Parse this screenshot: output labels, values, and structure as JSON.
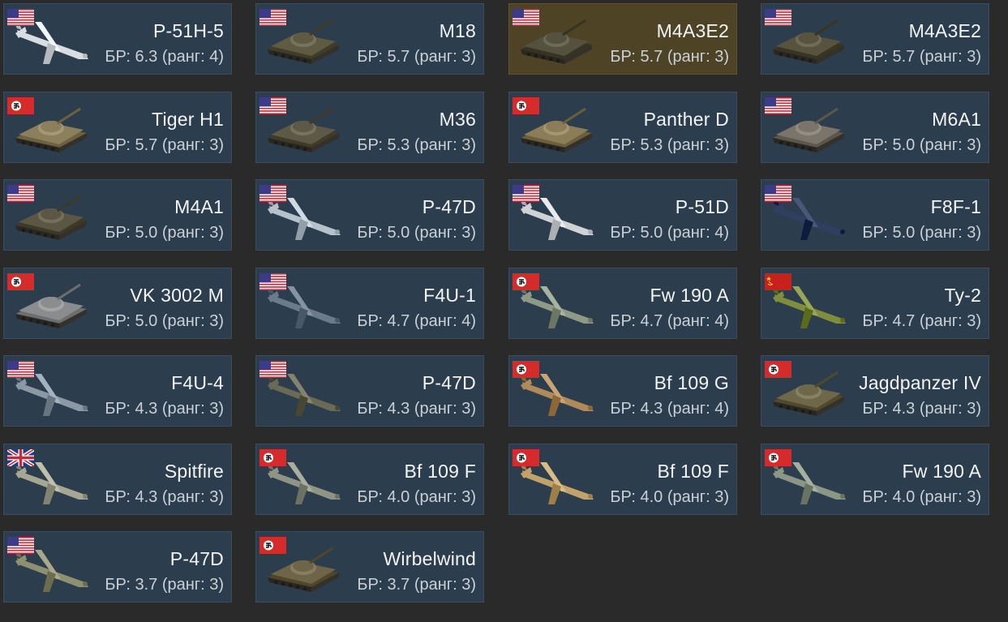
{
  "colors": {
    "background": "#2a2a2a",
    "card": "#2c3d4e",
    "card_selected": "#4e4425",
    "text_primary": "#f2f4f6",
    "text_secondary": "#c9d0d7"
  },
  "units": [
    {
      "name": "P-51H-5",
      "br": "БР: 6.3 (ранг: 4)",
      "flag": "usa-flag-icon",
      "kind": "plane",
      "color": "#d8dde2",
      "selected": false
    },
    {
      "name": "M18",
      "br": "БР: 5.7 (ранг: 3)",
      "flag": "usa-flag-icon",
      "kind": "tank",
      "color": "#5f5a44",
      "selected": false
    },
    {
      "name": "M4A3E2",
      "br": "БР: 5.7 (ранг: 3)",
      "flag": "usa-flag-icon",
      "kind": "tank",
      "color": "#54513f",
      "selected": true
    },
    {
      "name": "M4A3E2",
      "br": "БР: 5.7 (ранг: 3)",
      "flag": "usa-flag-icon",
      "kind": "tank",
      "color": "#58533f",
      "selected": false
    },
    {
      "name": "Tiger H1",
      "br": "БР: 5.7 (ранг: 3)",
      "flag": "germany-flag-icon",
      "kind": "tank",
      "color": "#8c7f5c",
      "selected": false
    },
    {
      "name": "M36",
      "br": "БР: 5.3 (ранг: 3)",
      "flag": "usa-flag-icon",
      "kind": "tank",
      "color": "#5e5946",
      "selected": false
    },
    {
      "name": "Panther D",
      "br": "БР: 5.3 (ранг: 3)",
      "flag": "germany-flag-icon",
      "kind": "tank",
      "color": "#8a7d58",
      "selected": false
    },
    {
      "name": "M6A1",
      "br": "БР: 5.0 (ранг: 3)",
      "flag": "usa-flag-icon",
      "kind": "tank",
      "color": "#7a746a",
      "selected": false
    },
    {
      "name": "M4A1",
      "br": "БР: 5.0 (ранг: 3)",
      "flag": "usa-flag-icon",
      "kind": "tank",
      "color": "#5c5744",
      "selected": false
    },
    {
      "name": "P-47D",
      "br": "БР: 5.0 (ранг: 3)",
      "flag": "usa-flag-icon",
      "kind": "plane",
      "color": "#b5c2cc",
      "selected": false
    },
    {
      "name": "P-51D",
      "br": "БР: 5.0 (ранг: 4)",
      "flag": "usa-flag-icon",
      "kind": "plane",
      "color": "#cfd3d6",
      "selected": false
    },
    {
      "name": "F8F-1",
      "br": "БР: 5.0 (ранг: 3)",
      "flag": "usa-flag-icon",
      "kind": "plane",
      "color": "#2e3f60",
      "selected": false
    },
    {
      "name": "VK 3002 M",
      "br": "БР: 5.0 (ранг: 3)",
      "flag": "germany-flag-icon",
      "kind": "tank",
      "color": "#8a8c8e",
      "selected": false
    },
    {
      "name": "F4U-1",
      "br": "БР: 4.7 (ранг: 4)",
      "flag": "usa-flag-icon",
      "kind": "plane",
      "color": "#6c7b8b",
      "selected": false
    },
    {
      "name": "Fw 190 A",
      "br": "БР: 4.7 (ранг: 4)",
      "flag": "germany-flag-icon",
      "kind": "plane",
      "color": "#8e9a86",
      "selected": false
    },
    {
      "name": "Ту-2",
      "br": "БР: 4.7 (ранг: 3)",
      "flag": "ussr-flag-icon",
      "kind": "plane",
      "color": "#7f8e3c",
      "selected": false
    },
    {
      "name": "F4U-4",
      "br": "БР: 4.3 (ранг: 3)",
      "flag": "usa-flag-icon",
      "kind": "plane",
      "color": "#8b98a6",
      "selected": false
    },
    {
      "name": "P-47D",
      "br": "БР: 4.3 (ранг: 3)",
      "flag": "usa-flag-icon",
      "kind": "plane",
      "color": "#6b6b55",
      "selected": false
    },
    {
      "name": "Bf 109 G",
      "br": "БР: 4.3 (ранг: 4)",
      "flag": "germany-flag-icon",
      "kind": "plane",
      "color": "#b08a58",
      "selected": false
    },
    {
      "name": "Jagdpanzer IV",
      "br": "БР: 4.3 (ранг: 3)",
      "flag": "germany-flag-icon",
      "kind": "tank",
      "color": "#6e6749",
      "selected": false
    },
    {
      "name": "Spitfire",
      "br": "БР: 4.3 (ранг: 3)",
      "flag": "uk-flag-icon",
      "kind": "plane",
      "color": "#a6a792",
      "selected": false
    },
    {
      "name": "Bf 109 F",
      "br": "БР: 4.0 (ранг: 3)",
      "flag": "germany-flag-icon",
      "kind": "plane",
      "color": "#8f9484",
      "selected": false
    },
    {
      "name": "Bf 109 F",
      "br": "БР: 4.0 (ранг: 3)",
      "flag": "germany-flag-icon",
      "kind": "plane",
      "color": "#c2a26b",
      "selected": false
    },
    {
      "name": "Fw 190 A",
      "br": "БР: 4.0 (ранг: 3)",
      "flag": "germany-flag-icon",
      "kind": "plane",
      "color": "#8c9686",
      "selected": false
    },
    {
      "name": "P-47D",
      "br": "БР: 3.7 (ранг: 3)",
      "flag": "usa-flag-icon",
      "kind": "plane",
      "color": "#8f9072",
      "selected": false
    },
    {
      "name": "Wirbelwind",
      "br": "БР: 3.7 (ранг: 3)",
      "flag": "germany-flag-icon",
      "kind": "tank",
      "color": "#6e6548",
      "selected": false
    }
  ]
}
